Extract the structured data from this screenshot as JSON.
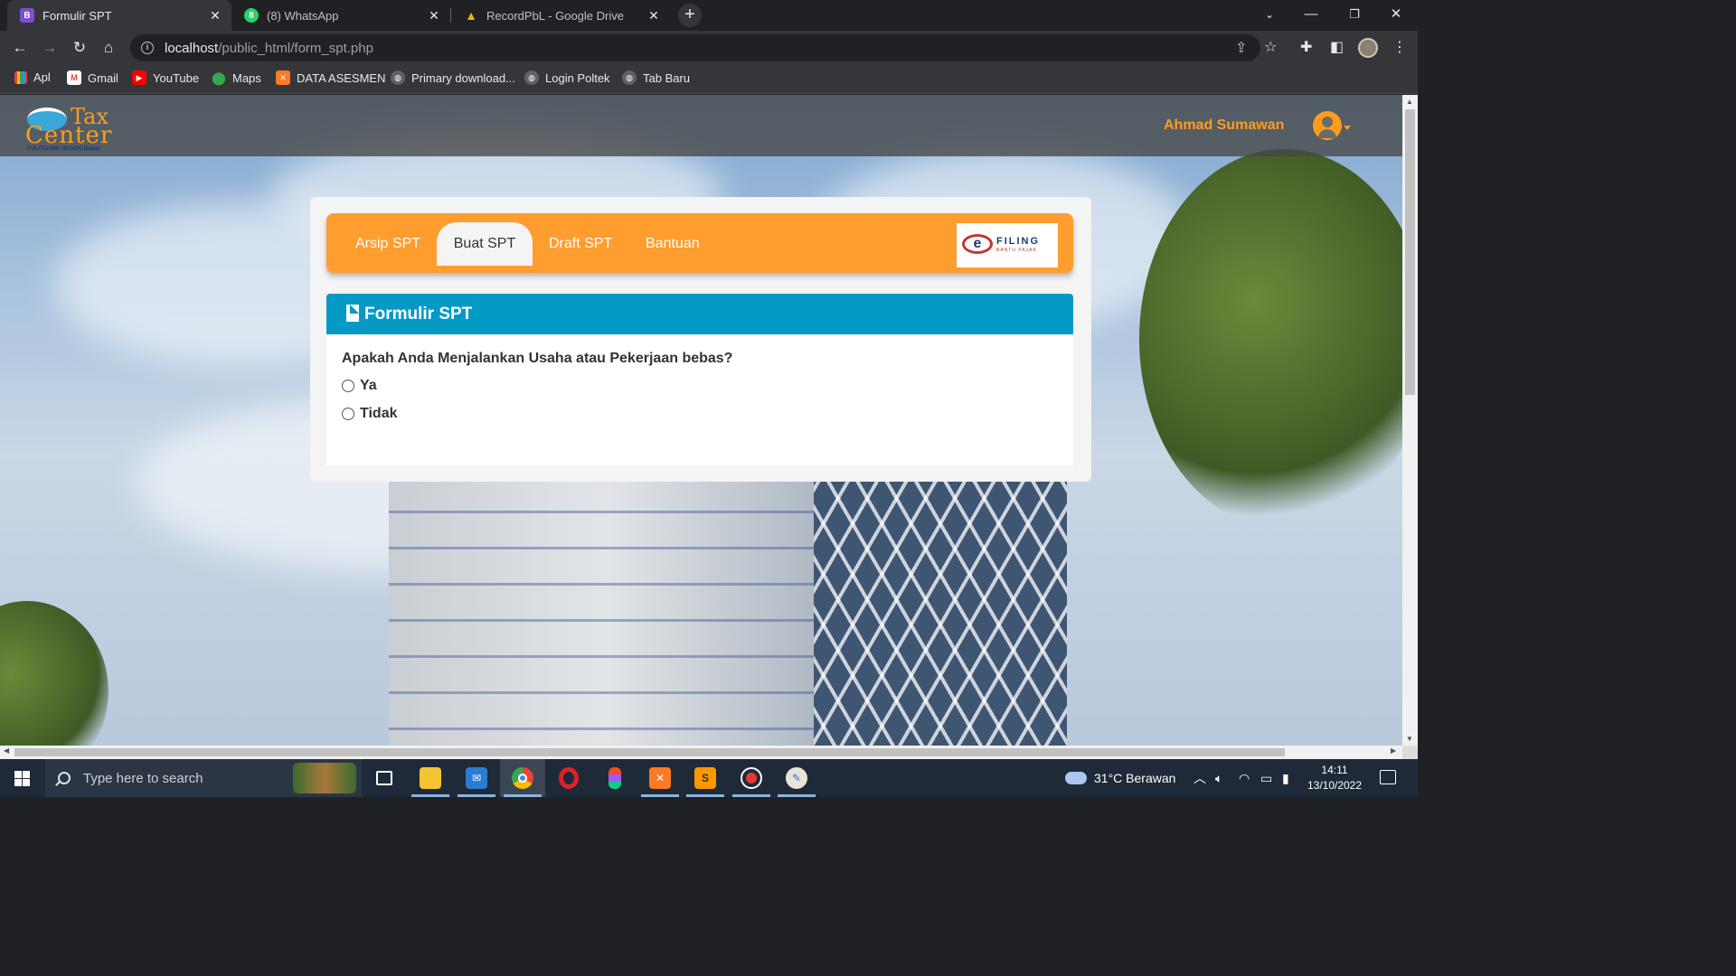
{
  "browser": {
    "tabs": [
      {
        "label": "Formulir SPT",
        "favicon": "B",
        "favicon_color": "#7b4fd0",
        "active": true
      },
      {
        "label": "(8) WhatsApp",
        "favicon": "8",
        "favicon_color": "#25d366",
        "active": false
      },
      {
        "label": "RecordPbL - Google Drive",
        "favicon": "▲",
        "favicon_color": "#f2b400",
        "active": false
      }
    ],
    "url_host": "localhost",
    "url_path": "/public_html/form_spt.php",
    "bookmarks": [
      {
        "label": "Apl",
        "icon": "apps-grid-icon",
        "color": "#4285f4"
      },
      {
        "label": "Gmail",
        "icon": "gmail-icon",
        "color": "#ea4335"
      },
      {
        "label": "YouTube",
        "icon": "youtube-icon",
        "color": "#ff0000"
      },
      {
        "label": "Maps",
        "icon": "maps-pin-icon",
        "color": "#34a853"
      },
      {
        "label": "DATA ASESMEN",
        "icon": "xampp-icon",
        "color": "#fb7a24"
      },
      {
        "label": "Primary download...",
        "icon": "globe-icon",
        "color": "#9aa0a6"
      },
      {
        "label": "Login Poltek",
        "icon": "globe-icon",
        "color": "#9aa0a6"
      },
      {
        "label": "Tab Baru",
        "icon": "globe-icon",
        "color": "#9aa0a6"
      }
    ]
  },
  "app": {
    "logo": {
      "line1": "Tax",
      "line2": "Center",
      "line3": "POLITEKNIK NEGERI Batam"
    },
    "username": "Ahmad Sumawan",
    "accent": "#ff9d2f",
    "nav": [
      {
        "label": "Arsip SPT",
        "active": false
      },
      {
        "label": "Buat SPT",
        "active": true
      },
      {
        "label": "Draft SPT",
        "active": false
      },
      {
        "label": "Bantuan",
        "active": false
      }
    ],
    "efiling": {
      "mark": "e",
      "title": "FILING",
      "subtitle": "BANTU PAJAK"
    },
    "panel": {
      "title": "Formulir SPT",
      "header_color": "#0599c6",
      "question": "Apakah Anda Menjalankan Usaha atau Pekerjaan bebas?",
      "options": [
        "Ya",
        "Tidak"
      ]
    }
  },
  "taskbar": {
    "search_placeholder": "Type here to search",
    "apps": [
      {
        "name": "task-view-icon"
      },
      {
        "name": "file-explorer-icon"
      },
      {
        "name": "mail-icon"
      },
      {
        "name": "chrome-icon"
      },
      {
        "name": "opera-icon"
      },
      {
        "name": "figma-icon"
      },
      {
        "name": "xampp-icon"
      },
      {
        "name": "sublime-text-icon"
      },
      {
        "name": "screen-recorder-icon"
      },
      {
        "name": "paint-icon"
      }
    ],
    "weather": "31°C  Berawan",
    "time": "14:11",
    "date": "13/10/2022"
  }
}
